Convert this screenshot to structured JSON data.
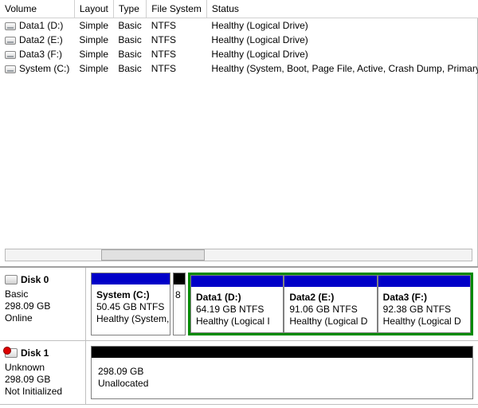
{
  "columns": {
    "volume": "Volume",
    "layout": "Layout",
    "type": "Type",
    "filesystem": "File System",
    "status": "Status"
  },
  "volumes": [
    {
      "name": "Data1 (D:)",
      "layout": "Simple",
      "type": "Basic",
      "fs": "NTFS",
      "status": "Healthy (Logical Drive)"
    },
    {
      "name": "Data2 (E:)",
      "layout": "Simple",
      "type": "Basic",
      "fs": "NTFS",
      "status": "Healthy (Logical Drive)"
    },
    {
      "name": "Data3 (F:)",
      "layout": "Simple",
      "type": "Basic",
      "fs": "NTFS",
      "status": "Healthy (Logical Drive)"
    },
    {
      "name": "System (C:)",
      "layout": "Simple",
      "type": "Basic",
      "fs": "NTFS",
      "status": "Healthy (System, Boot, Page File, Active, Crash Dump, Primary Par"
    }
  ],
  "disk0": {
    "title": "Disk 0",
    "type": "Basic",
    "size": "298.09 GB",
    "state": "Online",
    "parts": {
      "system": {
        "name": "System  (C:)",
        "line2": "50.45 GB NTFS",
        "line3": "Healthy (System,"
      },
      "hidden": {
        "name": "",
        "line2": "8",
        "line3": ""
      },
      "d": {
        "name": "Data1  (D:)",
        "line2": "64.19 GB NTFS",
        "line3": "Healthy (Logical I"
      },
      "e": {
        "name": "Data2  (E:)",
        "line2": "91.06 GB NTFS",
        "line3": "Healthy (Logical D"
      },
      "f": {
        "name": "Data3  (F:)",
        "line2": "92.38 GB NTFS",
        "line3": "Healthy (Logical D"
      }
    }
  },
  "disk1": {
    "title": "Disk 1",
    "type": "Unknown",
    "size": "298.09 GB",
    "state": "Not Initialized",
    "unalloc": {
      "line1": "298.09 GB",
      "line2": "Unallocated"
    }
  }
}
